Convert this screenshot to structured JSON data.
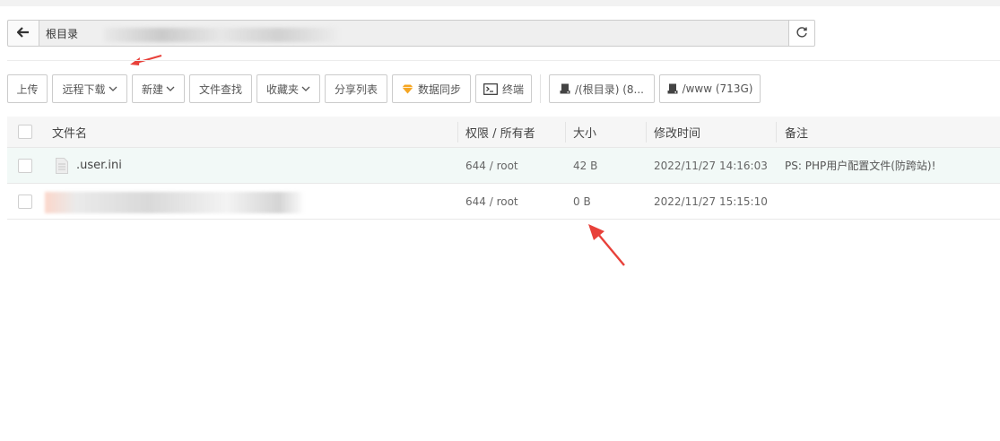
{
  "pathbar": {
    "root_label": "根目录"
  },
  "toolbar": {
    "upload": "上传",
    "remote_download": "远程下载",
    "new": "新建",
    "file_search": "文件查找",
    "favorites": "收藏夹",
    "share_list": "分享列表",
    "data_sync": "数据同步",
    "terminal": "终端",
    "disk_root": "/(根目录) (8...",
    "disk_www": "/www (713G)"
  },
  "table": {
    "headers": {
      "name": "文件名",
      "perm": "权限 / 所有者",
      "size": "大小",
      "mtime": "修改时间",
      "note": "备注"
    },
    "rows": [
      {
        "name": ".user.ini",
        "perm": "644 / root",
        "size": "42 B",
        "mtime": "2022/11/27 14:16:03",
        "note": "PS: PHP用户配置文件(防跨站)!"
      },
      {
        "name": "",
        "perm": "644 / root",
        "size": "0 B",
        "mtime": "2022/11/27 15:15:10",
        "note": ""
      }
    ]
  },
  "colors": {
    "accent_arrow": "#e8413a",
    "row_highlight": "#f2f9f7",
    "data_sync_icon": "#f5a623"
  },
  "icons": [
    "back-arrow-icon",
    "refresh-icon",
    "chevron-down-icon",
    "diamond-icon",
    "terminal-icon",
    "disk-icon",
    "file-icon",
    "annotation-arrow"
  ]
}
